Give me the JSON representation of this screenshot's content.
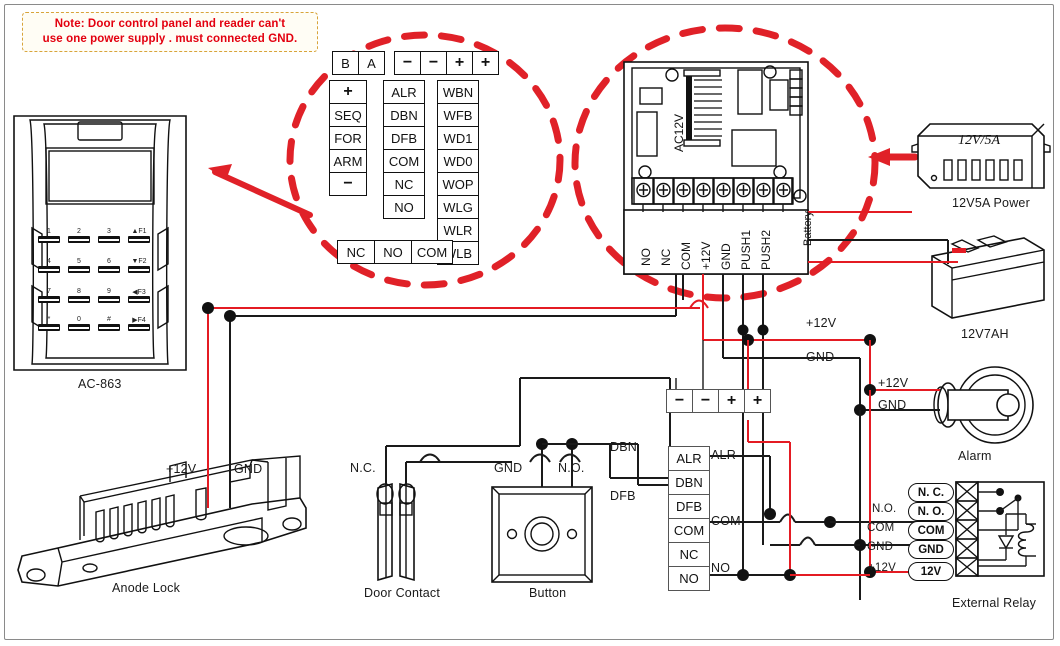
{
  "note": {
    "line1": "Note:  Door control panel and  reader can't",
    "line2": "use one power supply . must connected GND.",
    "color": "#e3000f",
    "border_color": "#d8a43a"
  },
  "reader": {
    "caption": "AC-863",
    "keys": [
      [
        "1",
        "2",
        "3",
        "▲F1"
      ],
      [
        "4",
        "5",
        "6",
        "▼F2"
      ],
      [
        "7",
        "8",
        "9",
        "◀F3"
      ],
      [
        "*",
        "0",
        "#",
        "▶F4"
      ]
    ]
  },
  "reader_terminals": {
    "ba": [
      "B",
      "A"
    ],
    "polarity": [
      "−",
      "−",
      "+",
      "+"
    ],
    "col_left": [
      "+",
      "SEQ",
      "FOR",
      "ARM",
      "−"
    ],
    "col_mid": [
      "ALR",
      "DBN",
      "DFB",
      "COM",
      "NC",
      "NO"
    ],
    "col_right": [
      "WBN",
      "WFB",
      "WD1",
      "WD0",
      "WOP",
      "WLG",
      "WLR",
      "WLB"
    ],
    "row_bottom": [
      "NC",
      "NO",
      "COM"
    ]
  },
  "controller": {
    "ac_label": "AC12V",
    "battery_label": "Battery",
    "terminals": [
      "NO",
      "NC",
      "COM",
      "+12V",
      "GND",
      "PUSH1",
      "PUSH2"
    ]
  },
  "power_supply": {
    "body_label": "12V/5A",
    "caption": "12V5A Power"
  },
  "battery": {
    "caption": "12V7AH"
  },
  "alarm": {
    "caption": "Alarm",
    "wire_plus": "+12V",
    "wire_gnd": "GND"
  },
  "lock": {
    "caption": "Anode Lock",
    "wire_plus": "+12V",
    "wire_gnd": "GND"
  },
  "door_contact": {
    "caption": "Door Contact",
    "wire_nc": "N.C."
  },
  "button": {
    "caption": "Button",
    "wire_gnd": "GND",
    "wire_no": "N.O."
  },
  "panel_terminals": {
    "polarity": [
      "−",
      "−",
      "+",
      "+"
    ],
    "column": [
      "ALR",
      "DBN",
      "DFB",
      "COM",
      "NC",
      "NO"
    ],
    "wire_labels": [
      "ALR",
      "COM",
      "NO",
      "DBN",
      "DFB"
    ]
  },
  "external_relay": {
    "caption": "External Relay",
    "pins": [
      "N. C.",
      "N. O.",
      "COM",
      "GND",
      "12V"
    ],
    "wire_labels": [
      "N.O.",
      "COM",
      "GND",
      "+12V"
    ]
  },
  "bus_labels": {
    "plus12v_top": "+12V",
    "gnd_top": "GND",
    "plus12v_alarm": "+12V",
    "gnd_alarm": "GND"
  },
  "colors": {
    "wire_red": "#e41b23",
    "wire_black": "#1a1a1a",
    "dash_red": "#e02128",
    "outline": "#111111"
  }
}
